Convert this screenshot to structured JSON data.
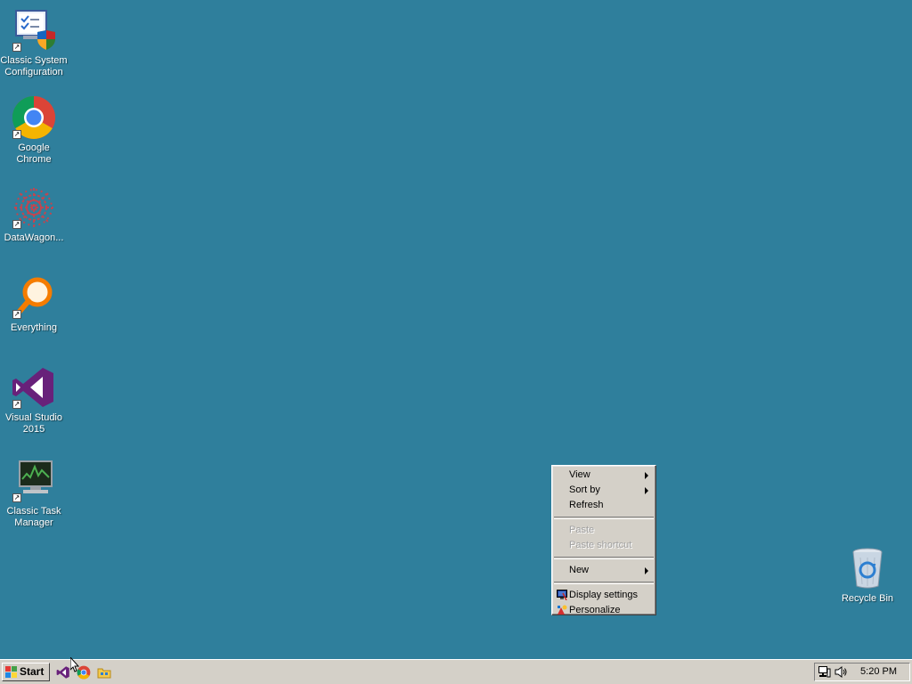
{
  "desktop": {
    "background": "#2f7f9c",
    "icons": [
      {
        "label": "Classic System Configuration"
      },
      {
        "label": "Google Chrome"
      },
      {
        "label": "DataWagon..."
      },
      {
        "label": "Everything"
      },
      {
        "label": "Visual Studio 2015"
      },
      {
        "label": "Classic Task Manager"
      },
      {
        "label": "Recycle Bin"
      }
    ]
  },
  "context_menu": {
    "items": [
      {
        "label": "View",
        "submenu": true,
        "enabled": true
      },
      {
        "label": "Sort by",
        "submenu": true,
        "enabled": true
      },
      {
        "label": "Refresh",
        "enabled": true
      },
      {
        "label": "Paste",
        "enabled": false
      },
      {
        "label": "Paste shortcut",
        "enabled": false
      },
      {
        "label": "New",
        "submenu": true,
        "enabled": true
      },
      {
        "label": "Display settings",
        "icon": "display-settings-icon",
        "enabled": true
      },
      {
        "label": "Personalize",
        "icon": "personalize-icon",
        "enabled": true
      }
    ]
  },
  "taskbar": {
    "start_label": "Start",
    "quick_launch": [
      {
        "icon": "visual-studio-icon"
      },
      {
        "icon": "chrome-icon"
      },
      {
        "icon": "folder-icon"
      }
    ],
    "tray": {
      "icons": [
        "network-icon",
        "volume-icon"
      ],
      "clock": "5:20 PM"
    }
  }
}
